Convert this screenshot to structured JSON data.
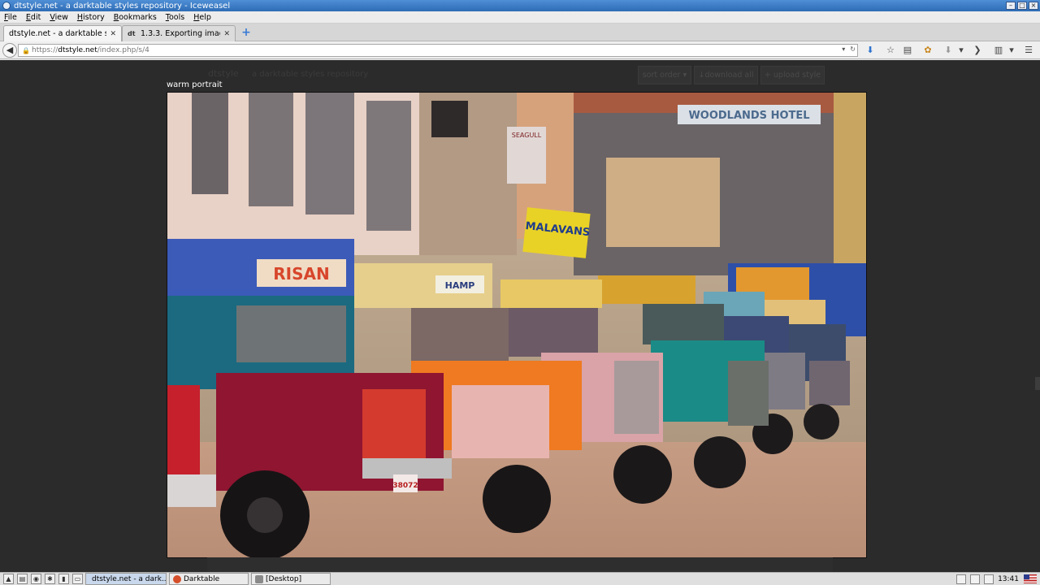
{
  "window": {
    "title": "dtstyle.net - a darktable styles repository - Iceweasel",
    "controls": [
      "–",
      "□",
      "×"
    ]
  },
  "menu": [
    "File",
    "Edit",
    "View",
    "History",
    "Bookmarks",
    "Tools",
    "Help"
  ],
  "tabs": [
    {
      "label": "dtstyle.net - a darktable sty...",
      "active": true
    },
    {
      "label": "1.3.3. Exporting images ...",
      "favicon": "dt",
      "active": false
    }
  ],
  "new_tab_label": "+",
  "urlbar": {
    "scheme": "https://",
    "host": "dtstyle.net",
    "path": "/index.php/s/4"
  },
  "site": {
    "brand": "dtstyle",
    "tagline": "a darktable styles repository",
    "buttons": {
      "sort": "sort order ▾",
      "download": "↓download all",
      "upload": "+ upload style"
    }
  },
  "lightbox": {
    "title": "warm portrait",
    "image_alt": "street photo of colorful trucks lined up",
    "signs": {
      "risan": "RISAN",
      "hotel": "WOODLANDS HOTEL",
      "malavans": "MALAVANS",
      "seagull": "SEAGULL",
      "plate_front": "38072"
    }
  },
  "taskbar": {
    "tasks": [
      {
        "label": "dtstyle.net - a dark...",
        "active": true
      },
      {
        "label": "Darktable",
        "active": false
      },
      {
        "label": "[Desktop]",
        "active": false
      }
    ],
    "clock": "13:41"
  },
  "colors": {
    "page_bg": "#2b2b2b",
    "title_bar": "#3a7bd5"
  }
}
